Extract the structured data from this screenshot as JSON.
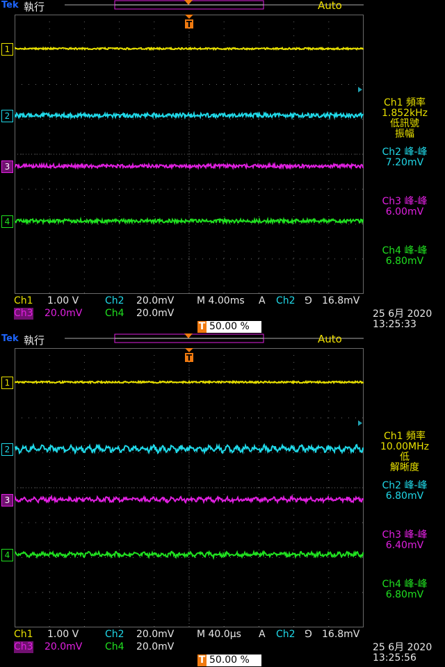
{
  "screens": [
    {
      "logo": "Tek",
      "mode": "執行",
      "acquire": "Auto",
      "channel_markers": [
        "1",
        "2",
        "3",
        "4"
      ],
      "readouts": [
        {
          "lines": [
            "Ch1 頻率",
            "1.852kHz",
            "低訊號",
            "振幅"
          ]
        },
        {
          "lines": [
            "Ch2 峰-峰",
            "7.20mV"
          ]
        },
        {
          "lines": [
            "Ch3 峰-峰",
            "6.00mV"
          ]
        },
        {
          "lines": [
            "Ch4 峰-峰",
            "6.80mV"
          ]
        }
      ],
      "status": {
        "ch1_label": "Ch1",
        "ch1_scale": "1.00 V",
        "ch2_label": "Ch2",
        "ch2_scale": "20.0mV",
        "ch3_label": "Ch3",
        "ch3_scale": "20.0mV",
        "ch4_label": "Ch4",
        "ch4_scale": "20.0mV",
        "timebase": "M 4.00ms",
        "trigger_type": "A",
        "trigger_source": "Ch2",
        "trigger_slope": "⅁",
        "trigger_level": "16.8mV",
        "trigger_position_badge": "T",
        "trigger_position": "50.00 %"
      },
      "date": "25 6月  2020",
      "time": "13:25:33",
      "waveform_ripple": "flat"
    },
    {
      "logo": "Tek",
      "mode": "執行",
      "acquire": "Auto",
      "channel_markers": [
        "1",
        "2",
        "3",
        "4"
      ],
      "readouts": [
        {
          "lines": [
            "Ch1 頻率",
            "10.00MHz",
            "低",
            "解晰度"
          ]
        },
        {
          "lines": [
            "Ch2 峰-峰",
            "6.80mV"
          ]
        },
        {
          "lines": [
            "Ch3 峰-峰",
            "6.40mV"
          ]
        },
        {
          "lines": [
            "Ch4 峰-峰",
            "6.80mV"
          ]
        }
      ],
      "status": {
        "ch1_label": "Ch1",
        "ch1_scale": "1.00 V",
        "ch2_label": "Ch2",
        "ch2_scale": "20.0mV",
        "ch3_label": "Ch3",
        "ch3_scale": "20.0mV",
        "ch4_label": "Ch4",
        "ch4_scale": "20.0mV",
        "timebase": "M 40.0µs",
        "trigger_type": "A",
        "trigger_source": "Ch2",
        "trigger_slope": "⅁",
        "trigger_level": "16.8mV",
        "trigger_position_badge": "T",
        "trigger_position": "50.00 %"
      },
      "date": "25 6月  2020",
      "time": "13:25:56",
      "waveform_ripple": "zigzag"
    }
  ],
  "colors": {
    "ch1": "#e8e000",
    "ch2": "#20d8e8",
    "ch3": "#e020e0",
    "ch4": "#20e020",
    "grid": "#6a6a6a",
    "trigger": "#f07a10"
  }
}
